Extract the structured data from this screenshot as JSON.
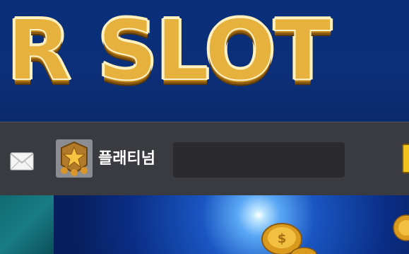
{
  "header": {
    "logo_text": "R SLOT"
  },
  "user_bar": {
    "icons": {
      "mail": "mail-icon",
      "rank": "rank-badge-icon"
    },
    "rank_label": "플래티넘",
    "username": ""
  },
  "banner": {
    "description": "promo-banner"
  },
  "colors": {
    "header_bg": "#0b2f78",
    "gold": "#e6b23d",
    "userbar_bg": "#3a3b40",
    "accent_yellow": "#f3c21a"
  }
}
